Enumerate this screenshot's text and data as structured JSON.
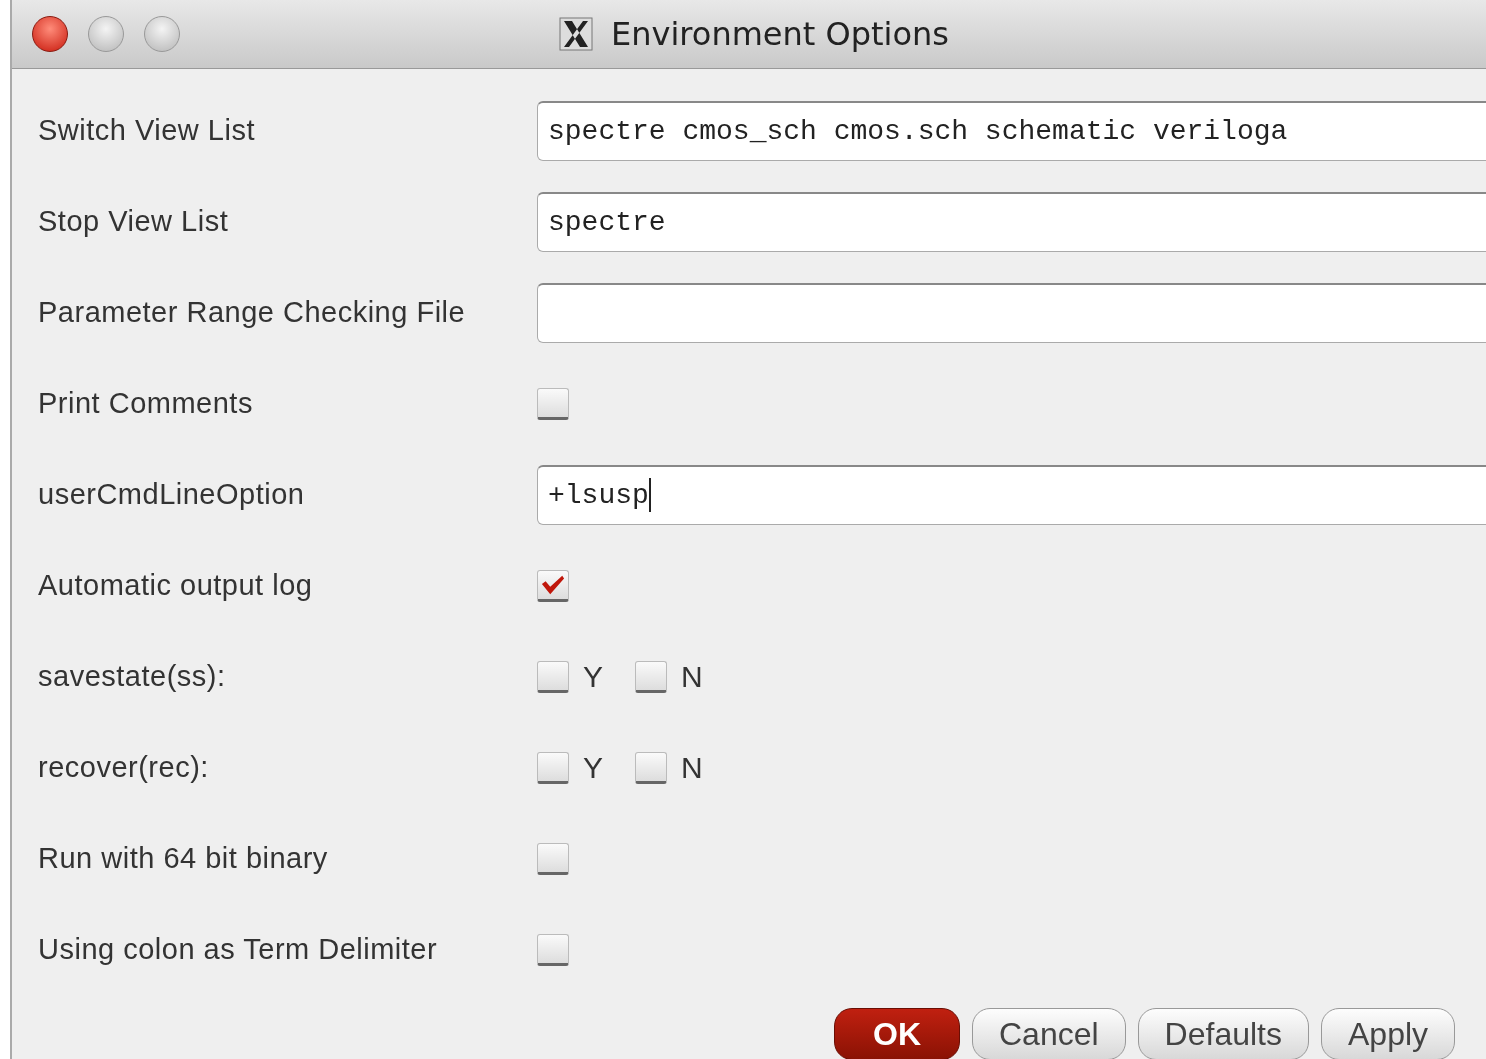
{
  "window": {
    "title": "Environment Options"
  },
  "rows": [
    {
      "kind": "text",
      "label": "Switch View List",
      "value": "spectre cmos_sch cmos.sch schematic veriloga"
    },
    {
      "kind": "text",
      "label": "Stop View List",
      "value": "spectre"
    },
    {
      "kind": "text",
      "label": "Parameter Range Checking File"
    },
    {
      "kind": "checkbox",
      "label": "Print Comments",
      "checked": false
    },
    {
      "kind": "text",
      "label": "userCmdLineOption",
      "value": "+lsusp"
    },
    {
      "kind": "checkbox",
      "label": "Automatic output log",
      "checked": true
    },
    {
      "kind": "yn",
      "label": "savestate(ss):",
      "options": [
        {
          "label": "Y",
          "checked": false
        },
        {
          "label": "N",
          "checked": false
        }
      ]
    },
    {
      "kind": "yn",
      "label": "recover(rec):",
      "options": [
        {
          "label": "Y",
          "checked": false
        },
        {
          "label": "N",
          "checked": false
        }
      ]
    },
    {
      "kind": "checkbox",
      "label": "Run with 64 bit binary",
      "checked": false
    },
    {
      "kind": "checkbox",
      "label": "Using colon as Term Delimiter",
      "checked": false
    }
  ],
  "buttons": [
    {
      "label": "OK",
      "default": true
    },
    {
      "label": "Cancel",
      "default": false
    },
    {
      "label": "Defaults",
      "default": false
    },
    {
      "label": "Apply",
      "default": false
    }
  ]
}
